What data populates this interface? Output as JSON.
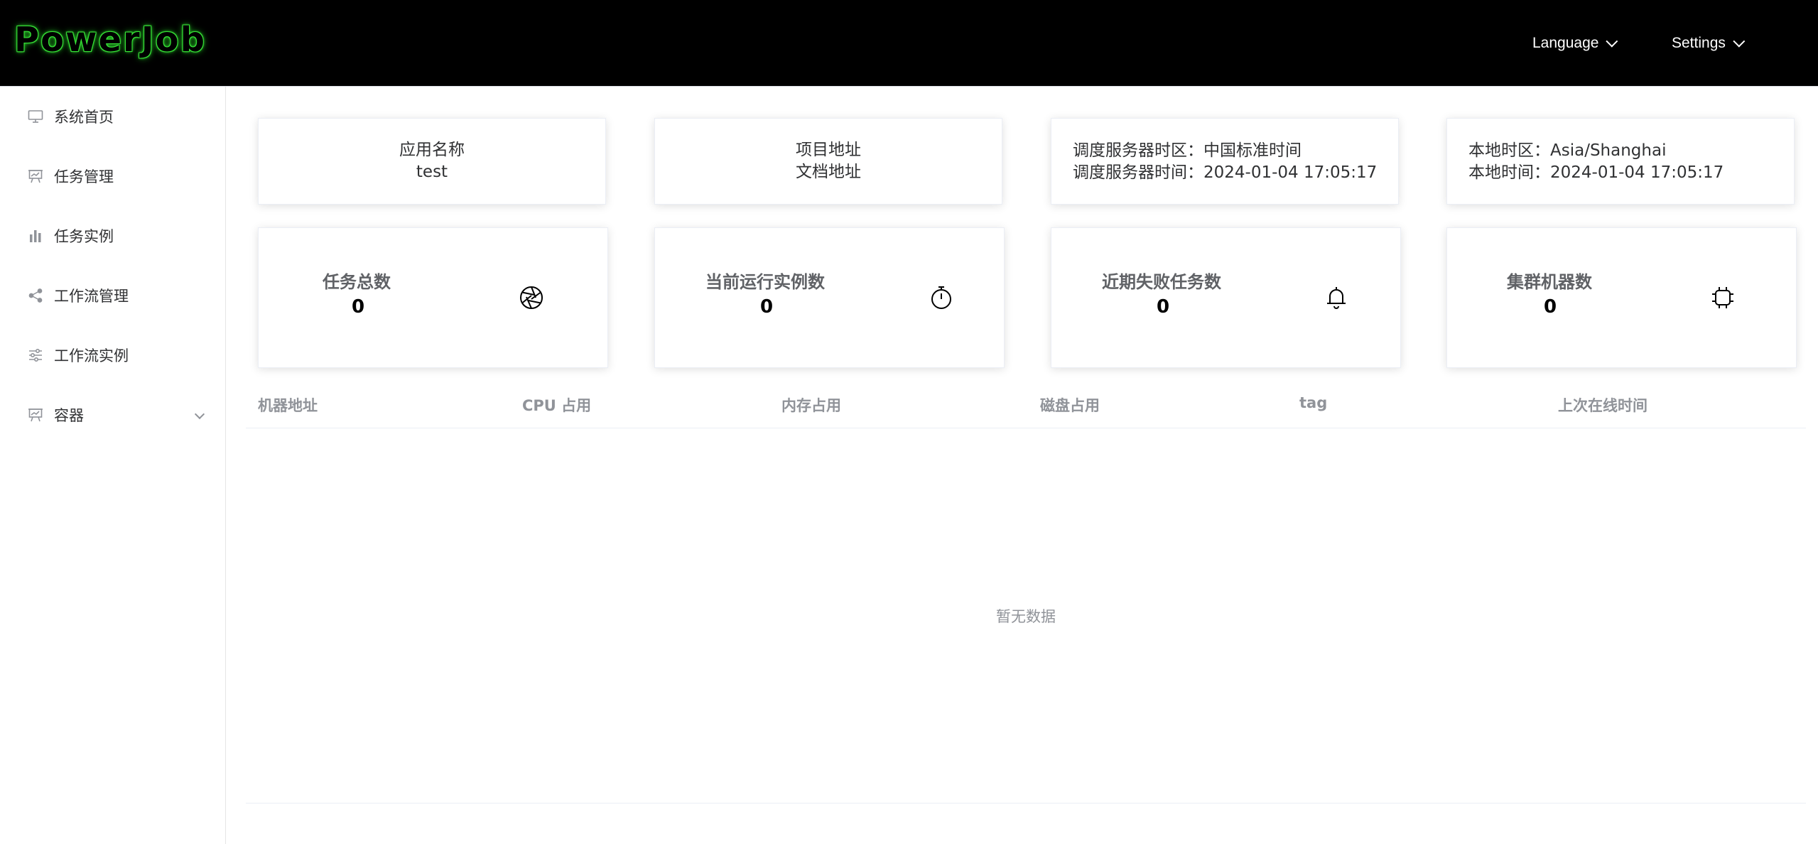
{
  "header": {
    "logo": "PowerJob",
    "language_label": "Language",
    "settings_label": "Settings"
  },
  "sidebar": {
    "items": [
      {
        "label": "系统首页",
        "icon": "monitor-icon"
      },
      {
        "label": "任务管理",
        "icon": "presentation-board-icon"
      },
      {
        "label": "任务实例",
        "icon": "bar-chart-icon"
      },
      {
        "label": "工作流管理",
        "icon": "share-icon"
      },
      {
        "label": "工作流实例",
        "icon": "sliders-icon"
      },
      {
        "label": "容器",
        "icon": "presentation-board-icon"
      }
    ]
  },
  "info": {
    "app_name_label": "应用名称",
    "app_name_value": "test",
    "project_link": "项目地址",
    "docs_link": "文档地址",
    "server_timezone": "调度服务器时区：中国标准时间",
    "server_time": "调度服务器时间：2024-01-04 17:05:17",
    "local_timezone": "本地时区：Asia/Shanghai",
    "local_time": "本地时间：2024-01-04 17:05:17"
  },
  "stats": [
    {
      "label": "任务总数",
      "value": "0",
      "icon": "aperture-icon"
    },
    {
      "label": "当前运行实例数",
      "value": "0",
      "icon": "stopwatch-icon"
    },
    {
      "label": "近期失败任务数",
      "value": "0",
      "icon": "bell-icon"
    },
    {
      "label": "集群机器数",
      "value": "0",
      "icon": "cpu-chip-icon"
    }
  ],
  "table": {
    "columns": [
      "机器地址",
      "CPU 占用",
      "内存占用",
      "磁盘占用",
      "tag",
      "上次在线时间"
    ],
    "empty_text": "暂无数据"
  }
}
